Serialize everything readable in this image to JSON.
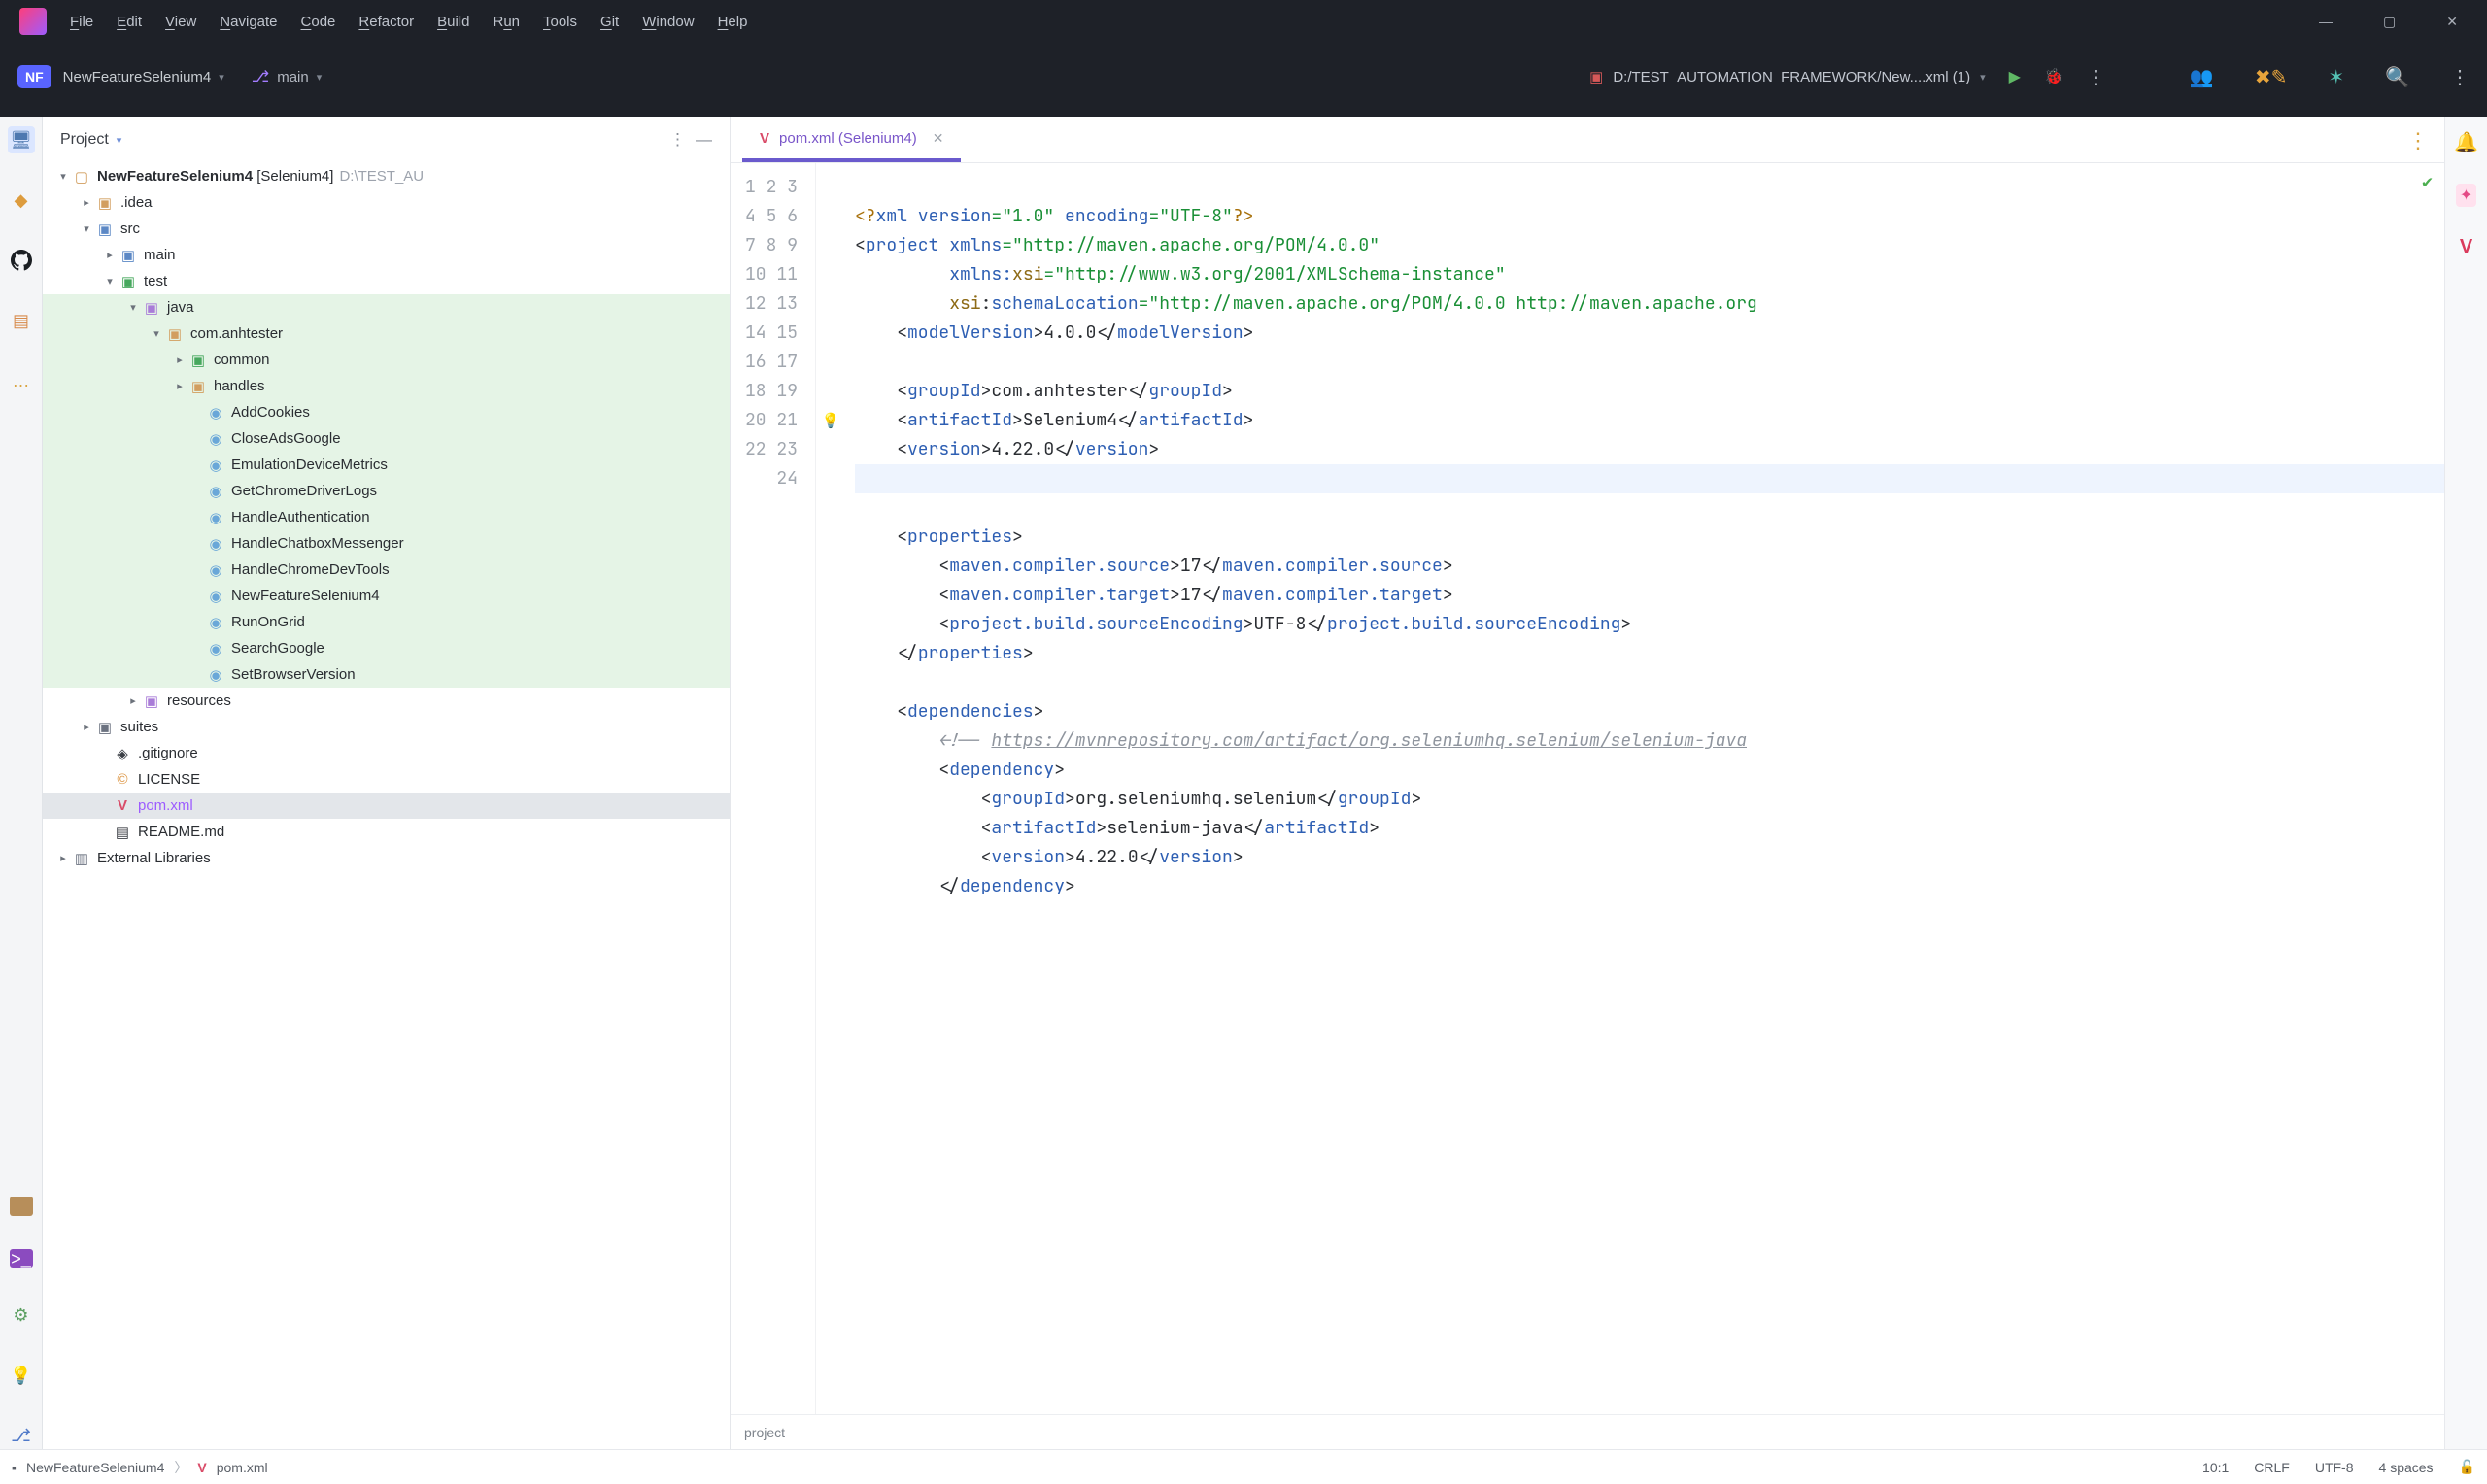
{
  "menus": [
    "File",
    "Edit",
    "View",
    "Navigate",
    "Code",
    "Refactor",
    "Build",
    "Run",
    "Tools",
    "Git",
    "Window",
    "Help"
  ],
  "project": {
    "badge": "NF",
    "name": "NewFeatureSelenium4",
    "branch": "main"
  },
  "runConfig": {
    "label": "D:/TEST_AUTOMATION_FRAMEWORK/New....xml (1)"
  },
  "projectPanel": {
    "title": "Project"
  },
  "tree": {
    "root": {
      "name": "NewFeatureSelenium4",
      "suffix": "[Selenium4]",
      "path": "D:\\TEST_AU"
    },
    "idea": ".idea",
    "src": "src",
    "main": "main",
    "test": "test",
    "java": "java",
    "pkg": "com.anhtester",
    "common": "common",
    "handles": "handles",
    "files": [
      "AddCookies",
      "CloseAdsGoogle",
      "EmulationDeviceMetrics",
      "GetChromeDriverLogs",
      "HandleAuthentication",
      "HandleChatboxMessenger",
      "HandleChromeDevTools",
      "NewFeatureSelenium4",
      "RunOnGrid",
      "SearchGoogle",
      "SetBrowserVersion"
    ],
    "resources": "resources",
    "suites": "suites",
    "gitignore": ".gitignore",
    "license": "LICENSE",
    "pom": "pom.xml",
    "readme": "README.md",
    "ext": "External Libraries"
  },
  "tab": {
    "title": "pom.xml (Selenium4)"
  },
  "crumb": "project",
  "status": {
    "root": "NewFeatureSelenium4",
    "file": "pom.xml",
    "pos": "10:1",
    "eol": "CRLF",
    "enc": "UTF-8",
    "indent": "4 spaces"
  },
  "code": {
    "l1a": "<?",
    "l1b": "xml version",
    "l1c": "=\"1.0\"",
    "l1d": " encoding",
    "l1e": "=\"UTF-8\"",
    "l1f": "?>",
    "l2a": "<",
    "l2b": "project ",
    "l2c": "xmlns",
    "l2d": "=\"http://maven.apache.org/POM/4.0.0\"",
    "l3a": "         ",
    "l3b": "xmlns:",
    "l3c": "xsi",
    "l3d": "=\"http://www.w3.org/2001/XMLSchema-instance\"",
    "l4a": "         ",
    "l4b": "xsi",
    "l4c": ":",
    "l4d": "schemaLocation",
    "l4e": "=\"http://maven.apache.org/POM/4.0.0 http://maven.apache.org",
    "l5a": "    <",
    "l5b": "modelVersion",
    "l5c": ">4.0.0</",
    "l5d": "modelVersion",
    "l5e": ">",
    "l7a": "    <",
    "l7b": "groupId",
    "l7c": ">com.anhtester</",
    "l7d": "groupId",
    "l7e": ">",
    "l8a": "    <",
    "l8b": "artifactId",
    "l8c": ">Selenium4</",
    "l8d": "artifactId",
    "l8e": ">",
    "l9a": "    <",
    "l9b": "version",
    "l9c": ">4.22.0</",
    "l9d": "version",
    "l9e": ">",
    "l11a": "    <",
    "l11b": "properties",
    "l11c": ">",
    "l12a": "        <",
    "l12b": "maven.compiler.source",
    "l12c": ">17</",
    "l12d": "maven.compiler.source",
    "l12e": ">",
    "l13a": "        <",
    "l13b": "maven.compiler.target",
    "l13c": ">17</",
    "l13d": "maven.compiler.target",
    "l13e": ">",
    "l14a": "        <",
    "l14b": "project.build.sourceEncoding",
    "l14c": ">UTF-8</",
    "l14d": "project.build.sourceEncoding",
    "l14e": ">",
    "l15a": "    </",
    "l15b": "properties",
    "l15c": ">",
    "l17a": "    <",
    "l17b": "dependencies",
    "l17c": ">",
    "l18a": "        ",
    "l18b": "<!-- ",
    "l18c": "https://mvnrepository.com/artifact/org.seleniumhq.selenium/selenium-java",
    "l19a": "        <",
    "l19b": "dependency",
    "l19c": ">",
    "l20a": "            <",
    "l20b": "groupId",
    "l20c": ">org.seleniumhq.selenium</",
    "l20d": "groupId",
    "l20e": ">",
    "l21a": "            <",
    "l21b": "artifactId",
    "l21c": ">selenium-java</",
    "l21d": "artifactId",
    "l21e": ">",
    "l22a": "            <",
    "l22b": "version",
    "l22c": ">4.22.0</",
    "l22d": "version",
    "l22e": ">",
    "l23a": "        </",
    "l23b": "dependency",
    "l23c": ">"
  }
}
